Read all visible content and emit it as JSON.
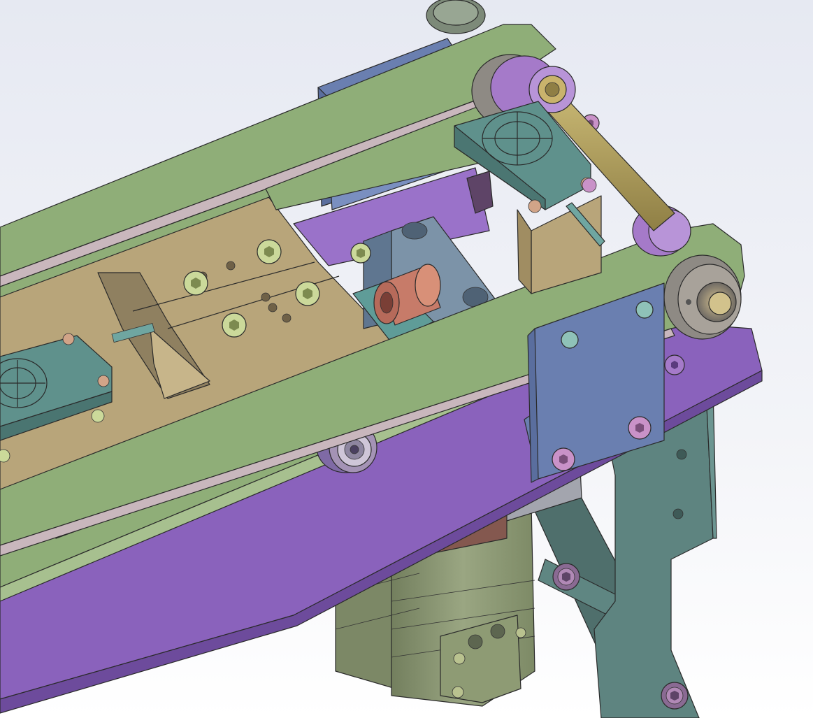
{
  "viewport": {
    "background_top": "#e9ebf3",
    "background_bottom": "#ffffff"
  },
  "colors": {
    "belt": "#8fae78",
    "belt_edge": "#6f8d5d",
    "belt_inner": "#c9b7bd",
    "base_plate": "#8760b8",
    "base_plate_dark": "#6e4b9f",
    "carriage": "#b8a57a",
    "carriage_dark": "#9e8b62",
    "bracket_blue": "#6a7fb0",
    "block_teal": "#5f9c98",
    "sensor_teal": "#5f918c",
    "stand": "#5e8480",
    "stand_dark": "#4c6c69",
    "motor": "#8c9874",
    "motor_dark": "#6f7b5d",
    "shaft": "#b8a662",
    "pulley": "#8e8a84",
    "bearing_violet": "#a57ac9",
    "copper_roller": "#c77b69",
    "screw_green": "#cbd99a",
    "screw_violet": "#c992c8",
    "coupler_brown": "#84584f",
    "coupler_grey": "#9ea0a8"
  },
  "icons": {
    "screws": "hex-socket-screw-icon",
    "sensor": "crosshair-target-icon",
    "pulley": "timing-pulley-icon",
    "bearing": "ball-bearing-icon"
  }
}
